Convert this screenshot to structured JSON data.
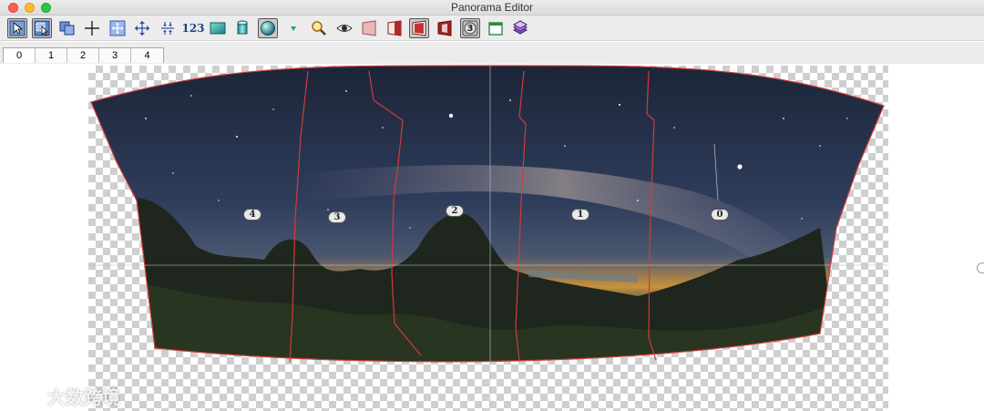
{
  "window": {
    "title": "Panorama Editor"
  },
  "toolbar": {
    "items": [
      {
        "name": "select-image-tool-icon",
        "pressed": true
      },
      {
        "name": "select-region-tool-icon",
        "pressed": true
      },
      {
        "name": "copy-images-icon",
        "pressed": false
      },
      {
        "name": "crosshair-tool-icon",
        "pressed": false
      },
      {
        "name": "fit-selection-icon",
        "pressed": false
      },
      {
        "name": "move-tool-icon",
        "pressed": false
      },
      {
        "name": "vertical-align-icon",
        "pressed": false
      },
      {
        "name": "number-labels-button",
        "label": "123",
        "pressed": false
      },
      {
        "name": "rectangle-view-icon",
        "pressed": false
      },
      {
        "name": "cylinder-projection-icon",
        "pressed": false
      },
      {
        "name": "sphere-projection-icon",
        "pressed": true
      },
      {
        "name": "dropdown-arrow-icon",
        "pressed": false
      },
      {
        "name": "magnifier-icon",
        "pressed": false
      },
      {
        "name": "eye-preview-icon",
        "pressed": false
      },
      {
        "name": "mask-tool-icon",
        "pressed": false
      },
      {
        "name": "mask-half-icon",
        "pressed": false
      },
      {
        "name": "mask-selected-icon",
        "pressed": true
      },
      {
        "name": "mask-dark-icon",
        "pressed": false
      },
      {
        "name": "layer-number-icon",
        "label": "3",
        "pressed": true
      },
      {
        "name": "window-layout-icon",
        "pressed": false
      },
      {
        "name": "layer-stack-icon",
        "pressed": false
      }
    ]
  },
  "tabs": [
    "0",
    "1",
    "2",
    "3",
    "4"
  ],
  "active_tab": 0,
  "canvas": {
    "image_labels": [
      "4",
      "3",
      "2",
      "1",
      "0"
    ],
    "seam_color": "#d33a3a"
  },
  "watermark": {
    "text": "大数跨境"
  },
  "colors": {
    "sky_top": "#1a2436",
    "sky_mid": "#2c3a58",
    "horizon_glow": "#d79a3a",
    "mountain": "#1f2a1e"
  }
}
